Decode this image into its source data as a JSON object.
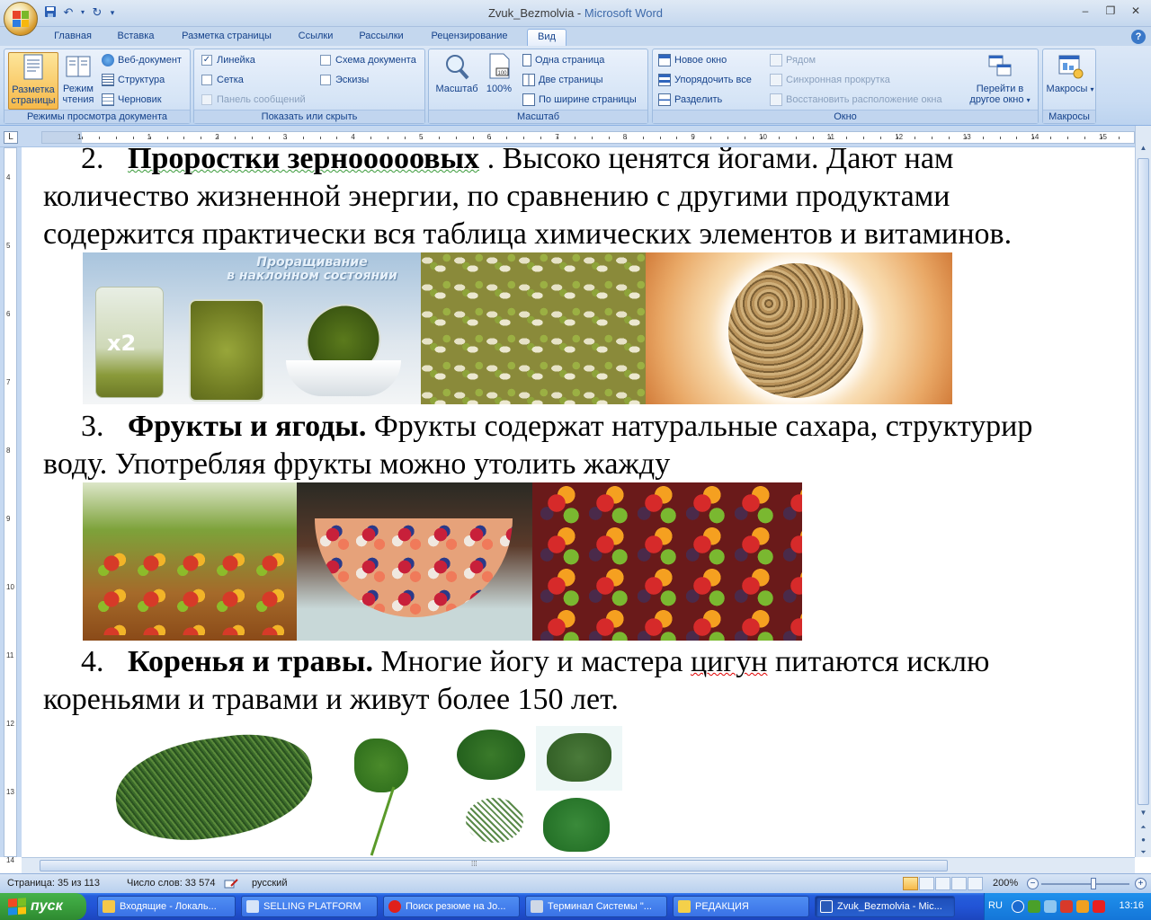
{
  "window": {
    "doc_name": "Zvuk_Bezmolvia",
    "separator": " - ",
    "app_name": "Microsoft Word"
  },
  "tabs": [
    "Главная",
    "Вставка",
    "Разметка страницы",
    "Ссылки",
    "Рассылки",
    "Рецензирование",
    "Вид"
  ],
  "active_tab": "Вид",
  "ribbon": {
    "views": {
      "label": "Режимы просмотра документа",
      "print_layout_l1": "Разметка",
      "print_layout_l2": "страницы",
      "reading_l1": "Режим",
      "reading_l2": "чтения",
      "web": "Веб-документ",
      "outline": "Структура",
      "draft": "Черновик"
    },
    "show": {
      "label": "Показать или скрыть",
      "ruler": "Линейка",
      "grid": "Сетка",
      "message_bar": "Панель сообщений",
      "doc_map": "Схема документа",
      "thumbnails": "Эскизы"
    },
    "zoom": {
      "label": "Масштаб",
      "zoom": "Масштаб",
      "p100": "100%",
      "one_page": "Одна страница",
      "two_pages": "Две страницы",
      "page_width": "По ширине страницы"
    },
    "window": {
      "label": "Окно",
      "new_window": "Новое окно",
      "arrange_all": "Упорядочить все",
      "split": "Разделить",
      "side_by_side": "Рядом",
      "sync_scroll": "Синхронная прокрутка",
      "reset_pos": "Восстановить расположение окна",
      "switch_l1": "Перейти в",
      "switch_l2": "другое окно"
    },
    "macros": {
      "label": "Макросы",
      "macros": "Макросы"
    }
  },
  "ruler_numbers": [
    "1",
    "1",
    "2",
    "3",
    "4",
    "5",
    "6",
    "7",
    "8",
    "9",
    "10",
    "11",
    "12",
    "13",
    "14",
    "15",
    "16"
  ],
  "vruler_numbers": [
    "4",
    "5",
    "6",
    "7",
    "8",
    "9",
    "10",
    "11",
    "12",
    "13",
    "14"
  ],
  "document": {
    "p1_num": "2.",
    "p1_bold": "Проростки зернооооовых",
    "p1_rest": " .  Высоко  ценятся  йогами.  Дают  нам",
    "p2": "количество  жизненной  энергии,  по  сравнению  с  другими  продуктами",
    "p3": "содержится практически вся таблица химических элементов и витаминов.",
    "img1_caption_l1": "Проращивание",
    "img1_caption_l2": "в наклонном состоянии",
    "img1_jar_label": "x2",
    "p4_num": "3.",
    "p4_bold": "Фрукты  и  ягоды.",
    "p4_rest": " Фрукты  содержат  натуральные  сахара,  структурир",
    "p5": "воду. Употребляя фрукты можно утолить жажду",
    "p6_num": "4.",
    "p6_bold": "Коренья  и  травы.",
    "p6_rest1": " Многие  йогу  и  мастера  ",
    "p6_spell": "цигун",
    "p6_rest2": "  питаются  исклю",
    "p7": "кореньями и травами и живут более 150 лет."
  },
  "status": {
    "page": "Страница: 35 из 113",
    "words": "Число слов: 33 574",
    "lang": "русский",
    "zoom": "200%"
  },
  "taskbar": {
    "start": "пуск",
    "items": [
      "Входящие - Локаль...",
      "SELLING PLATFORM",
      "Поиск резюме на Jo...",
      "Терминал Системы \"...",
      "РЕДАКЦИЯ",
      "Zvuk_Bezmolvia - Mic..."
    ],
    "lang": "RU",
    "clock": "13:16"
  }
}
